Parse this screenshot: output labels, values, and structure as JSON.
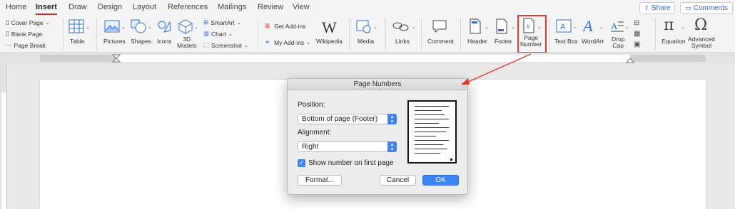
{
  "tabs": [
    "Home",
    "Insert",
    "Draw",
    "Design",
    "Layout",
    "References",
    "Mailings",
    "Review",
    "View"
  ],
  "active_tab": "Insert",
  "share_label": "Share",
  "comments_label": "Comments",
  "ribbon": {
    "pages": [
      "Cover Page",
      "Blank Page",
      "Page Break"
    ],
    "table": "Table",
    "pictures": "Pictures",
    "shapes": "Shapes",
    "icons": "Icons",
    "models_3d": "3D\nModels",
    "smartart": "SmartArt",
    "chart": "Chart",
    "screenshot": "Screenshot",
    "get_addins": "Get Add-ins",
    "my_addins": "My Add-ins",
    "wikipedia": "Wikipedia",
    "media": "Media",
    "links": "Links",
    "comment": "Comment",
    "header": "Header",
    "footer": "Footer",
    "page_number": "Page\nNumber",
    "text_box": "Text Box",
    "wordart": "WordArt",
    "drop_cap": "Drop\nCap",
    "equation": "Equation",
    "advanced_symbol": "Advanced\nSymbol"
  },
  "dialog": {
    "title": "Page Numbers",
    "position_label": "Position:",
    "position_value": "Bottom of page (Footer)",
    "alignment_label": "Alignment:",
    "alignment_value": "Right",
    "show_first_page_label": "Show number on first page",
    "show_first_page_checked": true,
    "format_button": "Format...",
    "cancel_button": "Cancel",
    "ok_button": "OK"
  },
  "colors": {
    "accent_red": "#e03c2d",
    "accent_blue": "#3d84f2"
  }
}
